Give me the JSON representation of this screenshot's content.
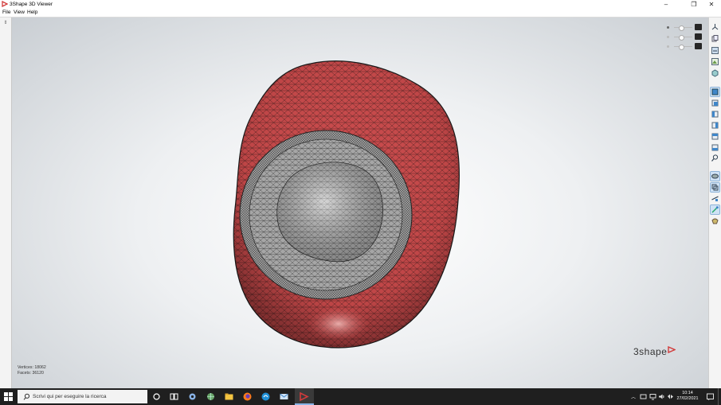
{
  "window": {
    "title": "3Shape 3D Viewer",
    "controls": {
      "minimize": "–",
      "restore": "❐",
      "close": "✕"
    }
  },
  "menu": {
    "file": "File",
    "view": "View",
    "help": "Help"
  },
  "leftstrip": {
    "pin": "⇕"
  },
  "viewer": {
    "vertices_label": "Vertices: 18062",
    "facets_label": "Facets: 36120",
    "logo": "3shape",
    "model_color": "#c8494a",
    "mesh_line_color": "#222222",
    "interior_color": "#b4b4b4"
  },
  "display_sliders": [
    {
      "name": "slider-1",
      "level": 0.35
    },
    {
      "name": "slider-2",
      "level": 0.35
    },
    {
      "name": "slider-3",
      "level": 0.35
    }
  ],
  "right_toolbar": [
    "axes-icon",
    "copy-icon",
    "measure-icon",
    "landscape-icon",
    "box-icon",
    "view-front-icon",
    "view-back-icon",
    "view-left-icon",
    "view-right-icon",
    "view-top-icon",
    "view-bottom-icon",
    "zoom-icon",
    "texture-icon",
    "mesh-icon",
    "section-icon",
    "tool-icon",
    "clip-icon"
  ],
  "taskbar": {
    "search_placeholder": "Scrivi qui per eseguire la ricerca",
    "time": "10:14",
    "date": "27/02/2021",
    "apps": [
      "cortana-icon",
      "task-view-icon",
      "settings-icon",
      "globe-icon",
      "explorer-icon",
      "firefox-icon",
      "edge-icon",
      "mail-icon",
      "3shape-icon"
    ],
    "tray": [
      "chevron-up-icon",
      "device-icon",
      "network-icon",
      "volume-icon",
      "keyboard-icon",
      "display-icon"
    ]
  },
  "colors": {
    "accent": "#d23b3b",
    "taskbar": "#1f1f1f",
    "active_button": "#cfe2f5"
  }
}
